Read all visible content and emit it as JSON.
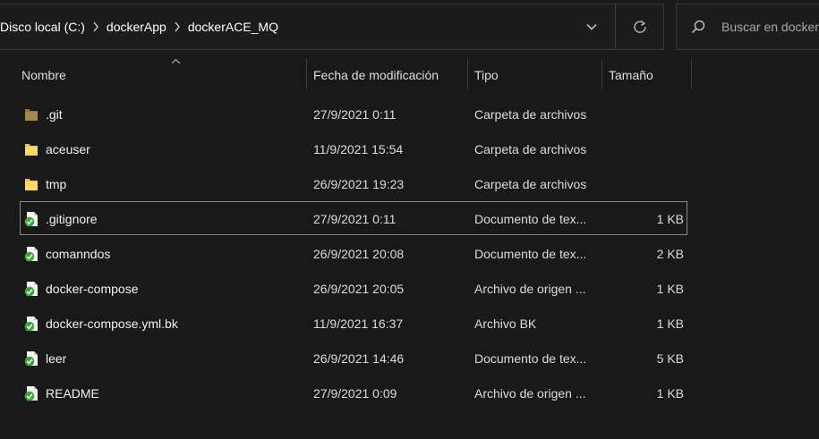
{
  "address_bar": {
    "breadcrumbs": [
      "Disco local (C:)",
      "dockerApp",
      "dockerACE_MQ"
    ]
  },
  "search": {
    "placeholder": "Buscar en docker"
  },
  "columns": {
    "name": "Nombre",
    "date": "Fecha de modificación",
    "type": "Tipo",
    "size": "Tamaño"
  },
  "sort": {
    "column": "name",
    "direction": "ascending"
  },
  "files": [
    {
      "name": ".git",
      "date": "27/9/2021 0:11",
      "type": "Carpeta de archivos",
      "size": "",
      "icon": "folder-hidden-icon"
    },
    {
      "name": "aceuser",
      "date": "11/9/2021 15:54",
      "type": "Carpeta de archivos",
      "size": "",
      "icon": "folder-icon"
    },
    {
      "name": "tmp",
      "date": "26/9/2021 19:23",
      "type": "Carpeta de archivos",
      "size": "",
      "icon": "folder-icon"
    },
    {
      "name": ".gitignore",
      "date": "27/9/2021 0:11",
      "type": "Documento de tex...",
      "size": "1 KB",
      "icon": "git-file-icon",
      "focused": true
    },
    {
      "name": "comanndos",
      "date": "26/9/2021 20:08",
      "type": "Documento de tex...",
      "size": "2 KB",
      "icon": "git-file-icon"
    },
    {
      "name": "docker-compose",
      "date": "26/9/2021 20:05",
      "type": "Archivo de origen ...",
      "size": "1 KB",
      "icon": "git-file-icon"
    },
    {
      "name": "docker-compose.yml.bk",
      "date": "11/9/2021 16:37",
      "type": "Archivo BK",
      "size": "1 KB",
      "icon": "git-file-icon"
    },
    {
      "name": "leer",
      "date": "26/9/2021 14:46",
      "type": "Documento de tex...",
      "size": "5 KB",
      "icon": "git-file-icon"
    },
    {
      "name": "README",
      "date": "27/9/2021 0:09",
      "type": "Archivo de origen ...",
      "size": "1 KB",
      "icon": "git-file-icon"
    }
  ],
  "colors": {
    "background": "#191919",
    "folder": "#f4c542",
    "git_badge": "#3aa637",
    "focus_border": "#8a8a8a"
  }
}
